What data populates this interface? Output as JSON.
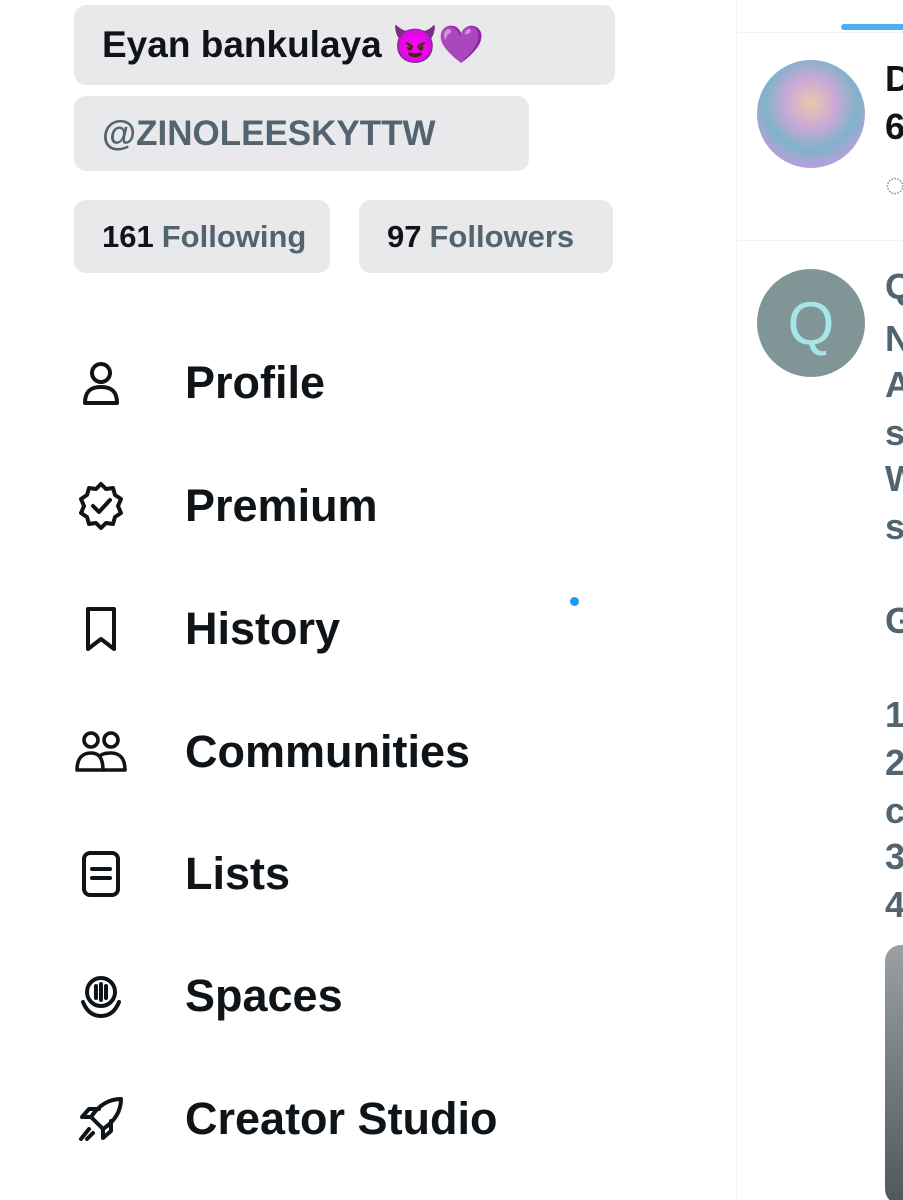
{
  "profile": {
    "display_name": "Eyan bankulaya 😈💜",
    "handle": "@ZINOLEESKYTTW",
    "following_count": "161",
    "following_label": "Following",
    "followers_count": "97",
    "followers_label": "Followers"
  },
  "nav": {
    "items": [
      {
        "label": "Profile",
        "icon": "person-icon"
      },
      {
        "label": "Premium",
        "icon": "verified-badge-icon"
      },
      {
        "label": "History",
        "icon": "bookmark-icon"
      },
      {
        "label": "Communities",
        "icon": "people-icon"
      },
      {
        "label": "Lists",
        "icon": "list-icon"
      },
      {
        "label": "Spaces",
        "icon": "microphone-icon"
      },
      {
        "label": "Creator Studio",
        "icon": "rocket-icon"
      }
    ]
  },
  "timeline": {
    "post1": {
      "name_fragment": "D",
      "meta_fragment": "6"
    },
    "post2": {
      "avatar_letter": "Q",
      "name_fragment": "Q",
      "lines": [
        "N",
        "A",
        "s",
        "W",
        "s",
        "",
        "G",
        "",
        "1",
        "2",
        "c",
        "3",
        "4"
      ]
    }
  },
  "colors": {
    "accent": "#1d9bf0",
    "pill_bg": "#e9e9ec",
    "text_primary": "#0f1419",
    "text_secondary": "#536471"
  }
}
